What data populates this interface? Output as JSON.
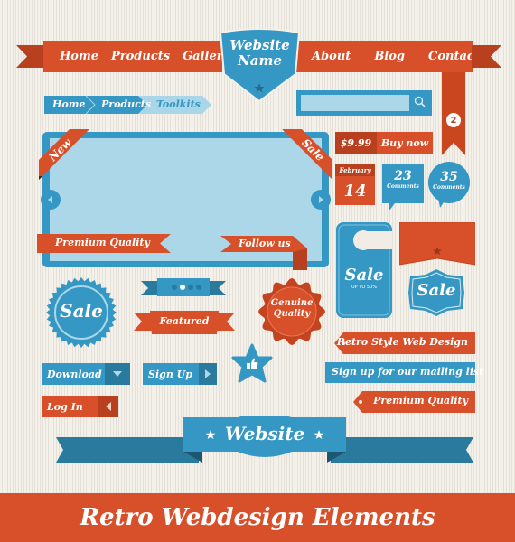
{
  "title": "Retro Webdesign Elements",
  "colors": {
    "orange": "#d8502a",
    "orange_dark": "#b9401f",
    "blue": "#3597c3",
    "blue_dark": "#2a7a9d",
    "light_blue": "#abd7e8",
    "background": "#f1ede6"
  },
  "nav": {
    "left_items": [
      "Home",
      "Products",
      "Gallery"
    ],
    "right_items": [
      "About",
      "Blog",
      "Contact"
    ],
    "logo_line1": "Website",
    "logo_line2": "Name",
    "bookmark_badge": "2"
  },
  "breadcrumb": [
    "Home",
    "Products",
    "Toolkits"
  ],
  "search": {
    "placeholder": "",
    "value": ""
  },
  "frame": {
    "corner_left": "New",
    "corner_right": "Sale",
    "ribbon_left": "Premium Quality",
    "ribbon_right": "Follow us"
  },
  "price": {
    "amount": "$9.99",
    "action": "Buy now"
  },
  "calendar": {
    "month": "February",
    "day": "14"
  },
  "comments_square": {
    "count": "23",
    "label": "Comments"
  },
  "comments_circle": {
    "count": "35",
    "label": "Comments"
  },
  "door_hanger": {
    "title": "Sale",
    "subtitle": "UP TO 50%"
  },
  "badge_sale_shield": "Sale",
  "badge_sale_round": "Sale",
  "pager": {
    "dots": 4,
    "active": 1
  },
  "featured_ribbon": "Featured",
  "seal": {
    "line1": "Genuine",
    "line2": "Quality"
  },
  "tags": [
    "Retro Style Web Design",
    "Sign up for our mailing list",
    "Premium Quality"
  ],
  "buttons": {
    "download": "Download",
    "signup": "Sign Up",
    "login": "Log In"
  },
  "website_ribbon": "Website",
  "footer_title": "Retro Webdesign Elements"
}
